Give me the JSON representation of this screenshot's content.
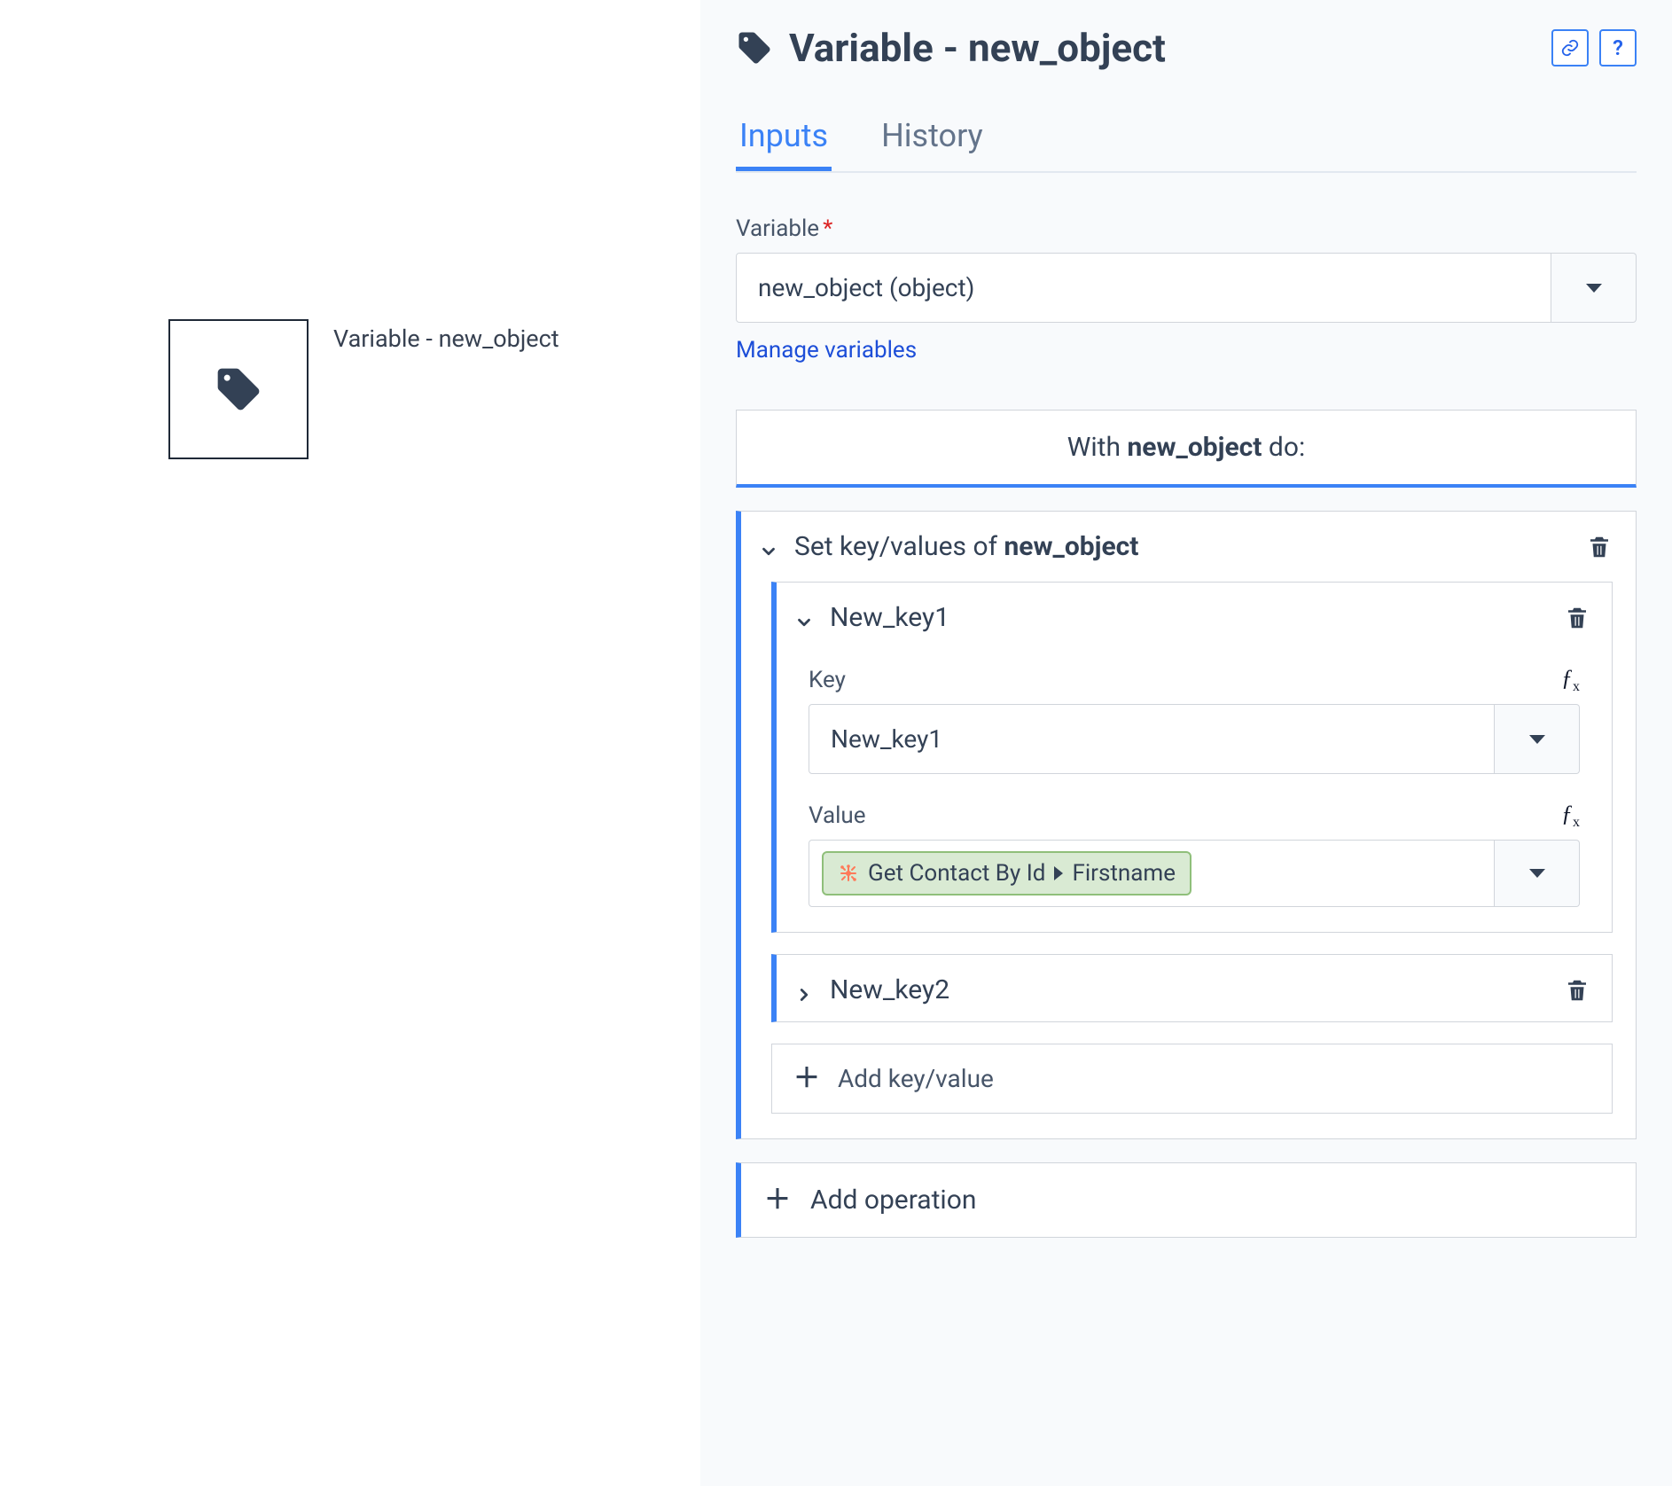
{
  "canvas": {
    "node_label": "Variable - new_object"
  },
  "panel": {
    "title": "Variable - new_object",
    "tabs": {
      "inputs": "Inputs",
      "history": "History"
    },
    "variable_section": {
      "label": "Variable",
      "value": "new_object (object)",
      "manage_link": "Manage variables"
    },
    "with_banner": {
      "prefix": "With ",
      "name": "new_object",
      "suffix": " do:"
    },
    "operation": {
      "title_prefix": "Set key/values of ",
      "title_name": "new_object",
      "keys": [
        {
          "name": "New_key1",
          "key_label": "Key",
          "key_value": "New_key1",
          "value_label": "Value",
          "value_chip": {
            "source": "Get Contact By Id",
            "field": "Firstname"
          }
        },
        {
          "name": "New_key2"
        }
      ],
      "add_kv": "Add key/value"
    },
    "add_operation": "Add operation"
  }
}
